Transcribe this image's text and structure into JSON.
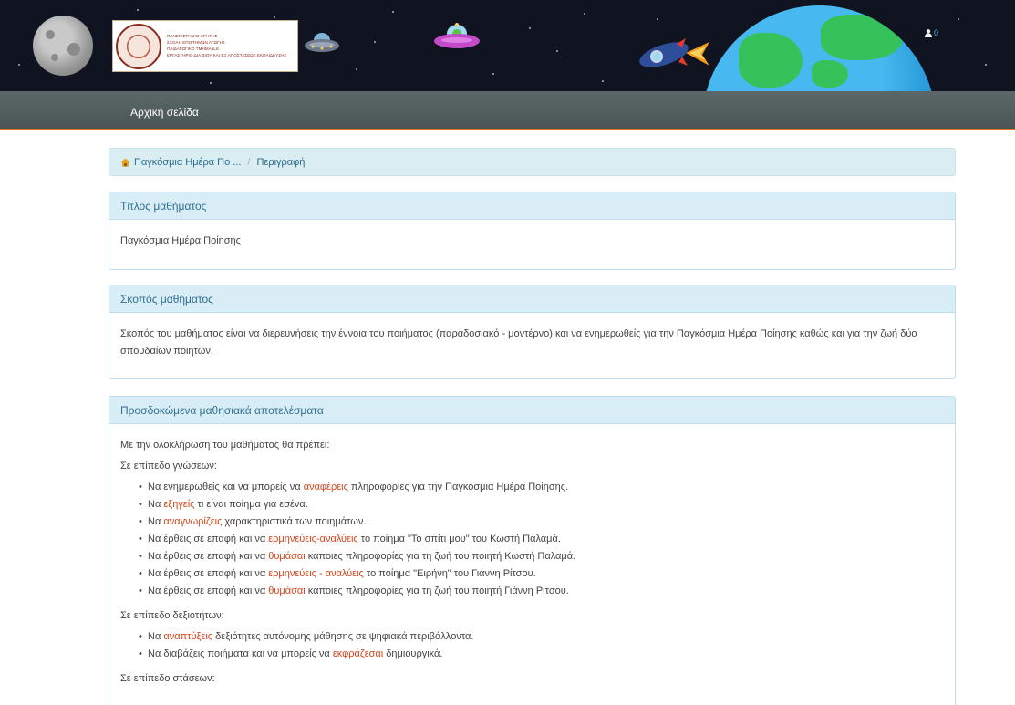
{
  "header": {
    "logo_lines": [
      "ΠΑΝΕΠΙΣΤΗΜΙΟ ΚΡΗΤΗΣ",
      "ΣΧΟΛΗ ΕΠΙΣΤΗΜΩΝ ΑΓΩΓΗΣ",
      "ΠΑΙΔΑΓΩΓΙΚΟ ΤΜΗΜΑ Δ.Ε.",
      "ΕΡΓΑΣΤΗΡΙΟ ΔΙΑ ΒΙΟΥ ΚΑΙ ΕΞ ΑΠΟΣΤΑΣΕΩΣ ΕΚΠΑΙΔΕΥΣΗΣ"
    ],
    "user_count": "0"
  },
  "nav": {
    "home": "Αρχική σελίδα"
  },
  "breadcrumb": {
    "course": "Παγκόσμια Ημέρα Πο ...",
    "separator": "/",
    "current": "Περιγραφή"
  },
  "panels": {
    "title": {
      "heading": "Τίτλος μαθήματος",
      "body": "Παγκόσμια Ημέρα Ποίησης"
    },
    "purpose": {
      "heading": "Σκοπός μαθήματος",
      "body": "Σκοπός του μαθήματος είναι να διερευνήσεις την έννοια του ποιήματος (παραδοσιακό - μοντέρνο)  και να ενημερωθείς για την Παγκόσμια Ημέρα Ποίησης καθώς και για την ζωή δύο σπουδαίων ποιητών."
    },
    "outcomes": {
      "heading": "Προσδοκώμενα μαθησιακά αποτελέσματα",
      "intro": "Με την ολοκλήρωση του μαθήματος θα πρέπει:",
      "knowledge_label": "Σε επίπεδο γνώσεων:",
      "knowledge": [
        {
          "pre": "Να ενημερωθείς και να μπορείς να ",
          "hl": "αναφέρεις",
          "post": " πληροφορίες για την Παγκόσμια Ημέρα Ποίησης."
        },
        {
          "pre": "Να ",
          "hl": "εξηγείς",
          "post": " τι είναι ποίημα για εσένα."
        },
        {
          "pre": "Να ",
          "hl": "αναγνωρίζεις",
          "post": " χαρακτηριστικά των ποιημάτων."
        },
        {
          "pre": "Να έρθεις σε επαφή και να ",
          "hl": "ερμηνεύεις-αναλύεις",
          "post": " το ποίημα \"Το σπίτι μου\" του Κωστή Παλαμά."
        },
        {
          "pre": "Να έρθεις σε επαφή και να ",
          "hl": "θυμάσαι",
          "post": " κάποιες πληροφορίες για τη ζωή του ποιητή Κωστή Παλαμά."
        },
        {
          "pre": "Να έρθεις σε επαφή και να ",
          "hl": "ερμηνεύεις - αναλύεις",
          "post": " το ποίημα \"Ειρήνη\" του Γιάννη Ρίτσου."
        },
        {
          "pre": "Να έρθεις σε επαφή και να ",
          "hl": "θυμάσαι",
          "post": " κάποιες πληροφορίες για τη ζωή του ποιητή Γιάννη Ρίτσου."
        }
      ],
      "skills_label": "Σε επίπεδο δεξιοτήτων:",
      "skills": [
        {
          "pre": "Να ",
          "hl": "αναπτύξεις",
          "post": " δεξιότητες αυτόνομης μάθησης σε ψηφιακά περιβάλλοντα."
        },
        {
          "pre": "Να διαβάζεις ποιήματα και να μπορείς να ",
          "hl": "εκφράζεσαι",
          "post": " δημιουργικά."
        }
      ],
      "attitudes_label": "Σε επίπεδο στάσεων:"
    }
  },
  "colors": {
    "highlight": "#d2461b",
    "nav_accent": "#e8722a",
    "panel_heading": "#d9edf7"
  }
}
